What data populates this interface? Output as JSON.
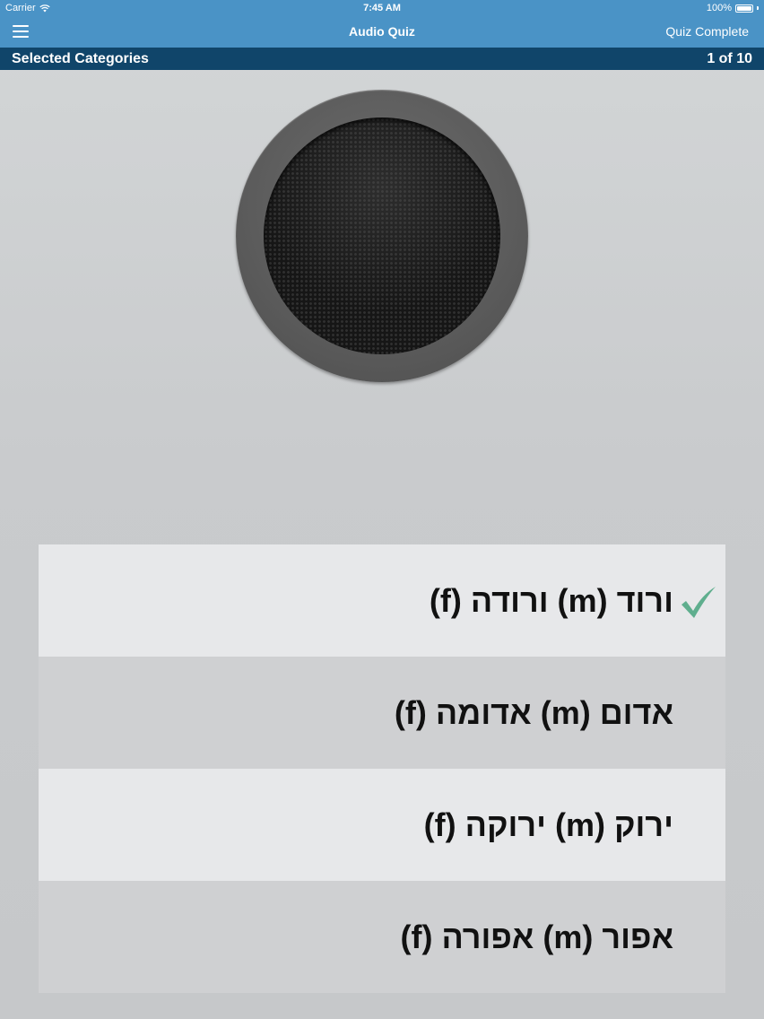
{
  "status_bar": {
    "carrier": "Carrier",
    "time": "7:45 AM",
    "battery_text": "100%",
    "battery_level": 1.0
  },
  "nav": {
    "title": "Audio Quiz",
    "right_button": "Quiz Complete"
  },
  "category_bar": {
    "title": "Selected Categories",
    "progress": "1 of 10"
  },
  "answers": [
    {
      "text": "ורוד (m)  ורודה (f)",
      "checked": true
    },
    {
      "text": "אדום (m)  אדומה (f)",
      "checked": false
    },
    {
      "text": "ירוק (m)  ירוקה (f)",
      "checked": false
    },
    {
      "text": "אפור (m)  אפורה (f)",
      "checked": false
    }
  ],
  "colors": {
    "nav_blue": "#4a93c6",
    "category_navy": "#10456a",
    "check_green": "#5fae8e"
  }
}
